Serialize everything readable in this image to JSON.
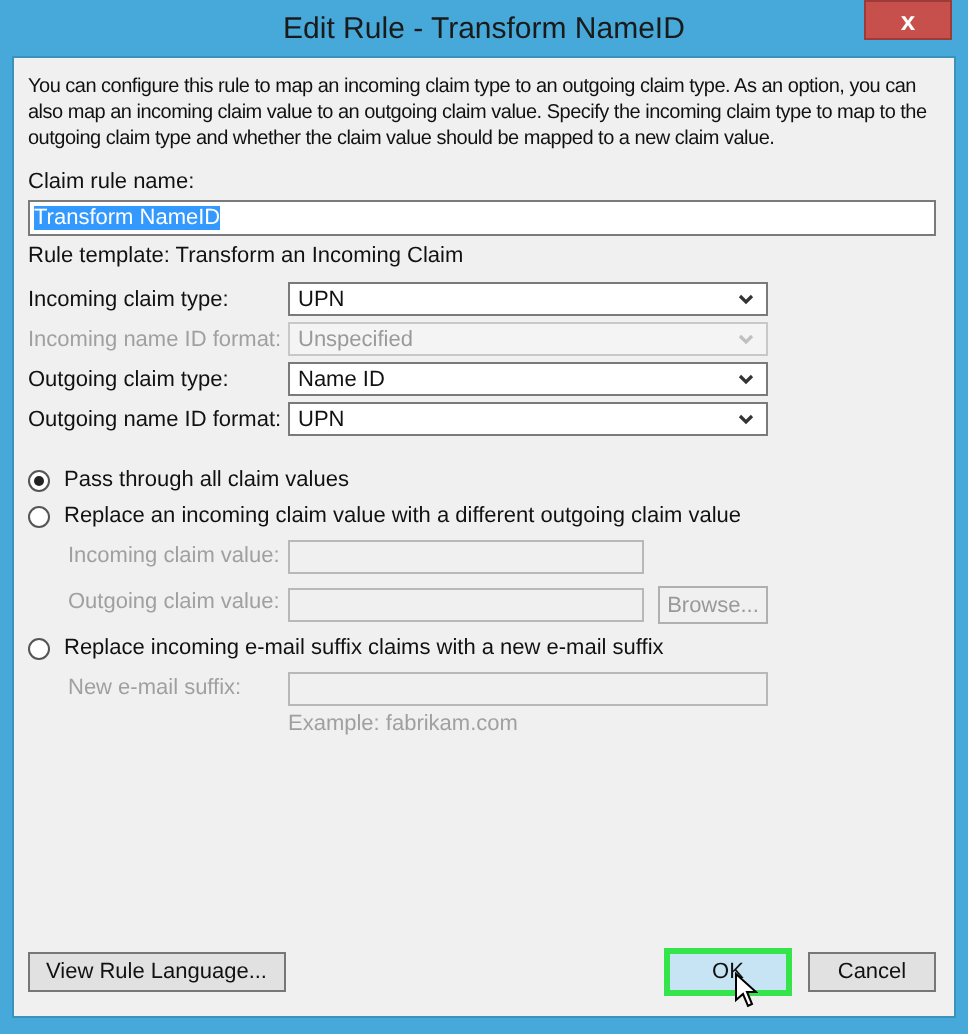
{
  "window": {
    "title": "Edit Rule - Transform NameID",
    "close": "x"
  },
  "description": "You can configure this rule to map an incoming claim type to an outgoing claim type. As an option, you can also map an incoming claim value to an outgoing claim value. Specify the incoming claim type to map to the outgoing claim type and whether the claim value should be mapped to a new claim value.",
  "rule_name": {
    "label": "Claim rule name:",
    "value": "Transform NameID",
    "text_selected": true
  },
  "rule_template": "Rule template: Transform an Incoming Claim",
  "dropdowns": [
    {
      "label": "Incoming claim type:",
      "value": "UPN",
      "disabled": false
    },
    {
      "label": "Incoming name ID format:",
      "value": "Unspecified",
      "disabled": true
    },
    {
      "label": "Outgoing claim type:",
      "value": "Name ID",
      "disabled": false
    },
    {
      "label": "Outgoing name ID format:",
      "value": "UPN",
      "disabled": false
    }
  ],
  "options": [
    {
      "label": "Pass through all claim values",
      "selected": true
    },
    {
      "label": "Replace an incoming claim value with a different outgoing claim value",
      "selected": false,
      "fields": [
        {
          "label": "Incoming claim value:",
          "disabled": true
        },
        {
          "label": "Outgoing claim value:",
          "disabled": true,
          "button": "Browse..."
        }
      ]
    },
    {
      "label": "Replace incoming e-mail suffix claims with a new e-mail suffix",
      "selected": false,
      "fields": [
        {
          "label": "New e-mail suffix:",
          "disabled": true,
          "hint": "Example: fabrikam.com"
        }
      ]
    }
  ],
  "buttons": [
    {
      "label": "View Rule Language...",
      "highlighted": false
    },
    {
      "label": "OK",
      "highlighted": true
    },
    {
      "label": "Cancel",
      "highlighted": false
    }
  ]
}
